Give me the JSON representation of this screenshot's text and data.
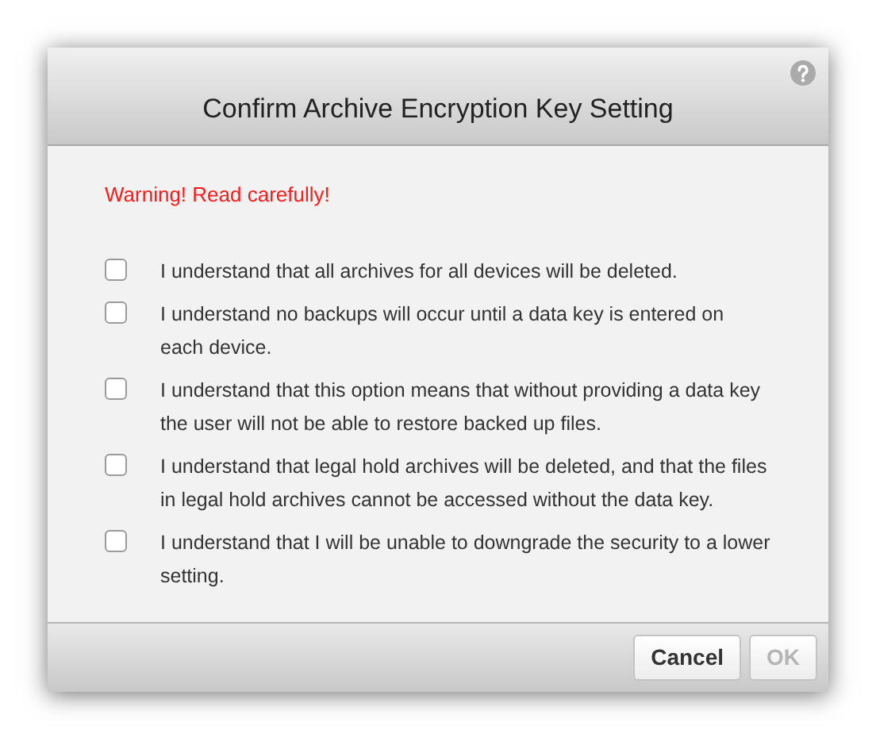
{
  "dialog": {
    "title": "Confirm Archive Encryption Key Setting",
    "warning": "Warning! Read carefully!",
    "items": [
      {
        "label": "I understand that all archives for all devices will be deleted.",
        "checked": false
      },
      {
        "label": "I understand no backups will occur until a data key is entered on each device.",
        "checked": false
      },
      {
        "label": "I understand that this option means that without providing a data key the user will not be able to restore backed up files.",
        "checked": false
      },
      {
        "label": "I understand that legal hold archives will be deleted, and that the files in legal hold archives cannot be accessed without the data key.",
        "checked": false
      },
      {
        "label": "I understand that I will be unable to downgrade the security to a lower setting.",
        "checked": false
      }
    ],
    "buttons": [
      {
        "label": "Cancel",
        "disabled": false
      },
      {
        "label": "OK",
        "disabled": true
      }
    ]
  }
}
